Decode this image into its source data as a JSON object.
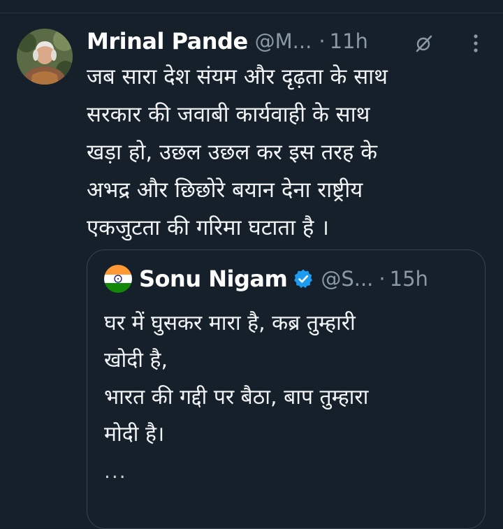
{
  "tweet": {
    "author_name": "Mrinal Pande",
    "handle": "@M...",
    "separator": "·",
    "time": "11h",
    "text": "जब सारा देश संयम और दृढ़ता के साथ\nसरकार की जवाबी कार्यवाही के साथ\nखड़ा हो, उछल उछल कर इस तरह के\nअभद्र और छिछोरे बयान देना राष्ट्रीय\nएकजुटता की गरिमा घटाता है ।"
  },
  "quoted_tweet": {
    "author_name": "Sonu Nigam",
    "handle": "@S...",
    "separator": "·",
    "time": "15h",
    "verified": true,
    "text": "घर में घुसकर मारा है, कब्र तुम्हारी\nखोदी है,\nभारत की गद्दी पर बैठा, बाप तुम्हारा\nमोदी है।",
    "truncation": "..."
  },
  "colors": {
    "background": "#15202b",
    "secondary_text": "#8b98a5",
    "verified_blue": "#1d9bf0",
    "border": "#38444d"
  },
  "icons": {
    "grok": "grok-slash-icon",
    "more": "more-vertical-icon",
    "verified": "verified-badge-icon",
    "flag": "india-flag-avatar"
  }
}
